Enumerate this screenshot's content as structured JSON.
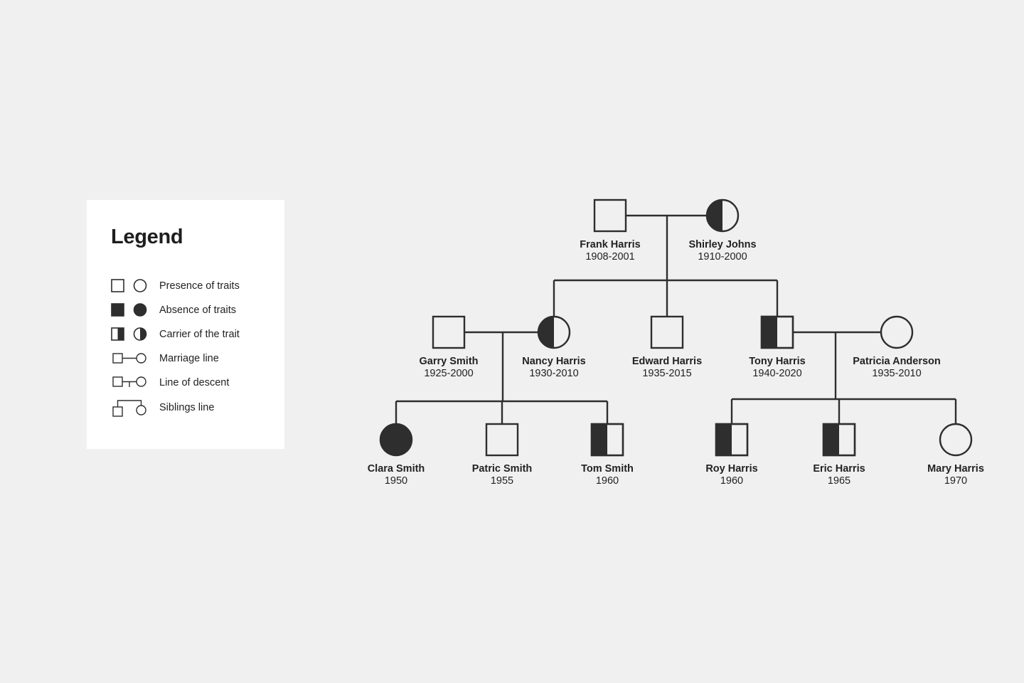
{
  "colors": {
    "background": "#f0f0f0",
    "ink": "#2e2e2e",
    "panel": "#ffffff",
    "fill_empty": "#f0f0f0"
  },
  "legend": {
    "title": "Legend",
    "items": [
      {
        "key": "presence",
        "label": "Presence of traits"
      },
      {
        "key": "absence",
        "label": "Absence of traits"
      },
      {
        "key": "carrier",
        "label": "Carrier of the trait"
      },
      {
        "key": "marriage",
        "label": "Marriage line"
      },
      {
        "key": "descent",
        "label": "Line of descent"
      },
      {
        "key": "siblings",
        "label": "Siblings line"
      }
    ]
  },
  "pedigree": {
    "people": [
      {
        "id": "frank",
        "name": "Frank Harris",
        "years": "1908-2001",
        "sex": "male",
        "status": "presence",
        "generation": 1
      },
      {
        "id": "shirley",
        "name": "Shirley Johns",
        "years": "1910-2000",
        "sex": "female",
        "status": "carrier",
        "generation": 1
      },
      {
        "id": "garry",
        "name": "Garry Smith",
        "years": "1925-2000",
        "sex": "male",
        "status": "presence",
        "generation": 2
      },
      {
        "id": "nancy",
        "name": "Nancy Harris",
        "years": "1930-2010",
        "sex": "female",
        "status": "carrier",
        "generation": 2
      },
      {
        "id": "edward",
        "name": "Edward Harris",
        "years": "1935-2015",
        "sex": "male",
        "status": "presence",
        "generation": 2
      },
      {
        "id": "tony",
        "name": "Tony Harris",
        "years": "1940-2020",
        "sex": "male",
        "status": "carrier",
        "generation": 2
      },
      {
        "id": "patricia",
        "name": "Patricia Anderson",
        "years": "1935-2010",
        "sex": "female",
        "status": "presence",
        "generation": 2
      },
      {
        "id": "clara",
        "name": "Clara Smith",
        "years": "1950",
        "sex": "female",
        "status": "absence",
        "generation": 3
      },
      {
        "id": "patric",
        "name": "Patric Smith",
        "years": "1955",
        "sex": "male",
        "status": "presence",
        "generation": 3
      },
      {
        "id": "tom",
        "name": "Tom Smith",
        "years": "1960",
        "sex": "male",
        "status": "carrier",
        "generation": 3
      },
      {
        "id": "roy",
        "name": "Roy Harris",
        "years": "1960",
        "sex": "male",
        "status": "carrier",
        "generation": 3
      },
      {
        "id": "eric",
        "name": "Eric Harris",
        "years": "1965",
        "sex": "male",
        "status": "carrier",
        "generation": 3
      },
      {
        "id": "mary",
        "name": "Mary Harris",
        "years": "1970",
        "sex": "female",
        "status": "presence",
        "generation": 3
      }
    ],
    "marriages": [
      {
        "partners": [
          "frank",
          "shirley"
        ],
        "children": [
          "nancy",
          "edward",
          "tony"
        ]
      },
      {
        "partners": [
          "garry",
          "nancy"
        ],
        "children": [
          "clara",
          "patric",
          "tom"
        ]
      },
      {
        "partners": [
          "tony",
          "patricia"
        ],
        "children": [
          "roy",
          "eric",
          "mary"
        ]
      }
    ]
  }
}
